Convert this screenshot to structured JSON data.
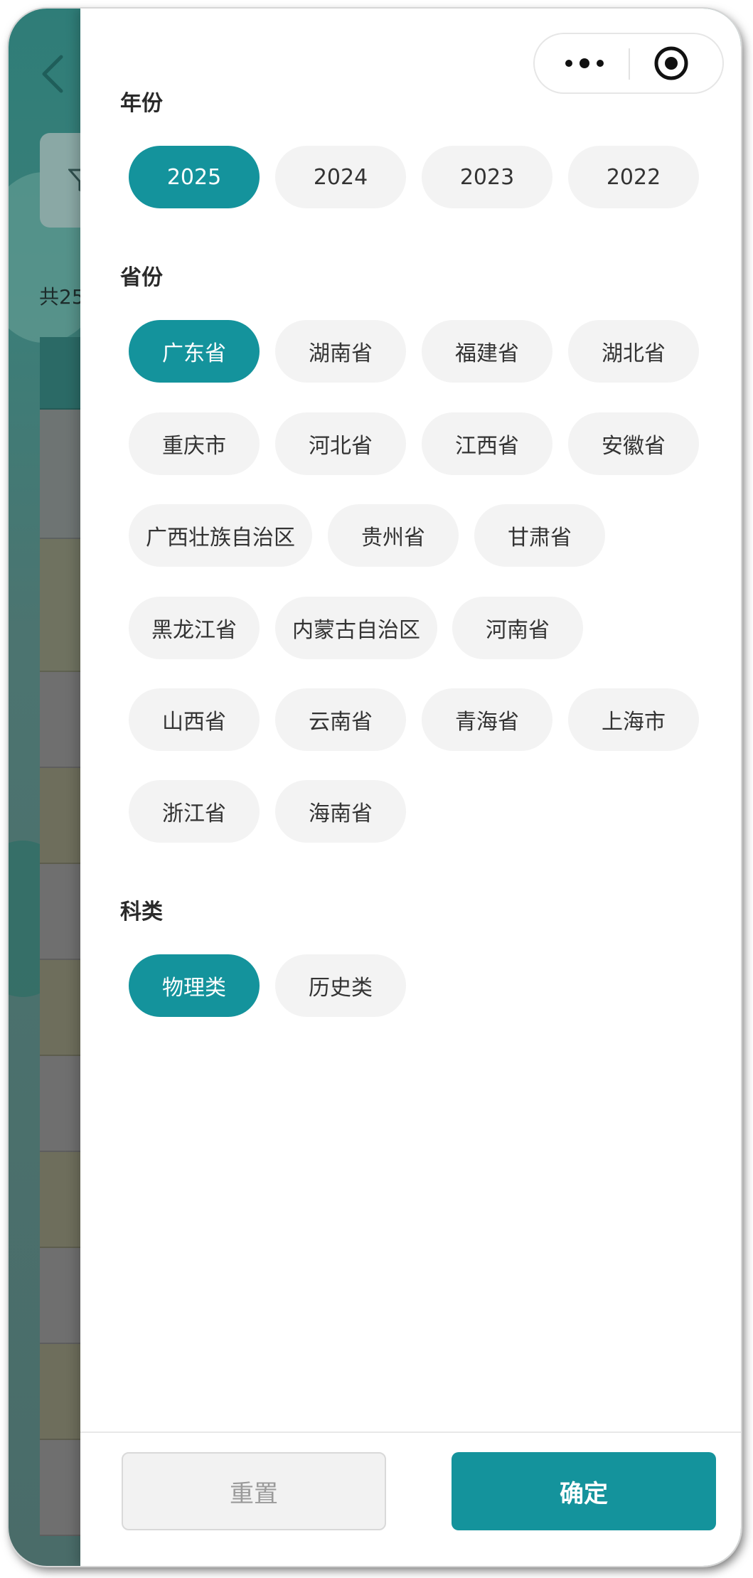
{
  "background": {
    "count_text": "共25"
  },
  "sections": [
    {
      "title": "年份",
      "options": [
        "2025",
        "2024",
        "2023",
        "2022"
      ],
      "selected": "2025"
    },
    {
      "title": "省份",
      "options": [
        "广东省",
        "湖南省",
        "福建省",
        "湖北省",
        "重庆市",
        "河北省",
        "江西省",
        "安徽省",
        "广西壮族自治区",
        "贵州省",
        "甘肃省",
        "黑龙江省",
        "内蒙古自治区",
        "河南省",
        "山西省",
        "云南省",
        "青海省",
        "上海市",
        "浙江省",
        "海南省"
      ],
      "selected": "广东省"
    },
    {
      "title": "科类",
      "options": [
        "物理类",
        "历史类"
      ],
      "selected": "物理类"
    }
  ],
  "footer": {
    "reset_label": "重置",
    "confirm_label": "确定"
  },
  "colors": {
    "accent": "#14939c",
    "chip_bg": "#f3f3f3"
  }
}
